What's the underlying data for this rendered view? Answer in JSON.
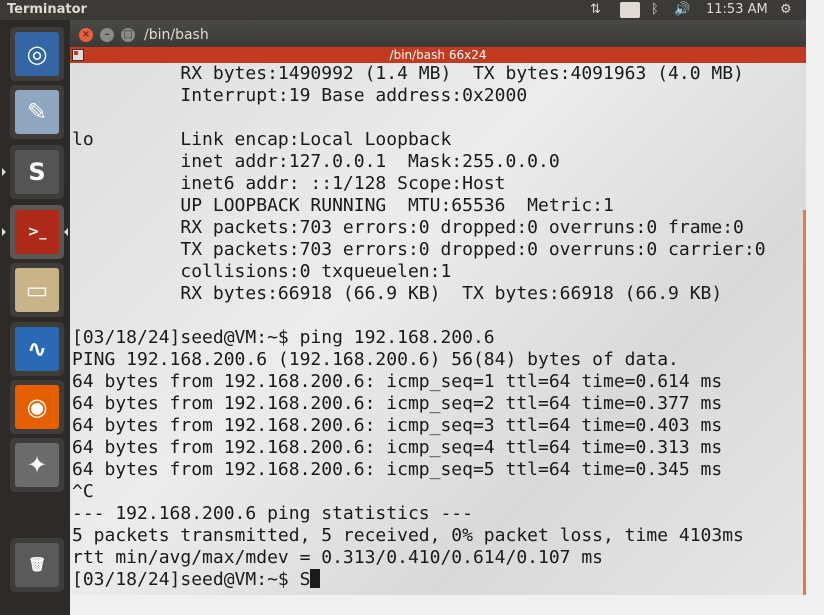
{
  "panel": {
    "app_title": "Terminator",
    "keyboard": "En",
    "clock": "11:53 AM",
    "network_glyph": "⇅",
    "bluetooth_glyph": "ᛒ",
    "volume_glyph": "🔊",
    "gear_glyph": "⚙"
  },
  "launcher": {
    "items": [
      {
        "name": "ubuntu-dash-icon",
        "glyph": "◎",
        "color": "#3465a4"
      },
      {
        "name": "text-editor-icon",
        "glyph": "✎",
        "color": "#8fa6bf"
      },
      {
        "name": "sublime-text-icon",
        "glyph": "S",
        "color": "#555555"
      },
      {
        "name": "terminator-icon",
        "glyph": ">_",
        "color": "#b02a1a"
      },
      {
        "name": "file-manager-icon",
        "glyph": "▭",
        "color": "#c9b48a"
      },
      {
        "name": "wireshark-icon",
        "glyph": "∿",
        "color": "#2a6ab4"
      },
      {
        "name": "firefox-icon",
        "glyph": "◉",
        "color": "#e66000"
      },
      {
        "name": "system-settings-icon",
        "glyph": "✦",
        "color": "#6b6b6b"
      },
      {
        "name": "trash-icon",
        "glyph": "🗑",
        "color": "#5a5a5a"
      }
    ]
  },
  "window": {
    "title": "/bin/bash",
    "close_glyph": "×",
    "min_glyph": "–",
    "max_glyph": "□"
  },
  "terminal": {
    "bar_title": "/bin/bash 66x24",
    "lines": [
      "          RX bytes:1490992 (1.4 MB)  TX bytes:4091963 (4.0 MB)",
      "          Interrupt:19 Base address:0x2000",
      "",
      "lo        Link encap:Local Loopback",
      "          inet addr:127.0.0.1  Mask:255.0.0.0",
      "          inet6 addr: ::1/128 Scope:Host",
      "          UP LOOPBACK RUNNING  MTU:65536  Metric:1",
      "          RX packets:703 errors:0 dropped:0 overruns:0 frame:0",
      "          TX packets:703 errors:0 dropped:0 overruns:0 carrier:0",
      "          collisions:0 txqueuelen:1",
      "          RX bytes:66918 (66.9 KB)  TX bytes:66918 (66.9 KB)",
      "",
      "[03/18/24]seed@VM:~$ ping 192.168.200.6",
      "PING 192.168.200.6 (192.168.200.6) 56(84) bytes of data.",
      "64 bytes from 192.168.200.6: icmp_seq=1 ttl=64 time=0.614 ms",
      "64 bytes from 192.168.200.6: icmp_seq=2 ttl=64 time=0.377 ms",
      "64 bytes from 192.168.200.6: icmp_seq=3 ttl=64 time=0.403 ms",
      "64 bytes from 192.168.200.6: icmp_seq=4 ttl=64 time=0.313 ms",
      "64 bytes from 192.168.200.6: icmp_seq=5 ttl=64 time=0.345 ms",
      "^C",
      "--- 192.168.200.6 ping statistics ---",
      "5 packets transmitted, 5 received, 0% packet loss, time 4103ms",
      "rtt min/avg/max/mdev = 0.313/0.410/0.614/0.107 ms"
    ],
    "prompt_line": "[03/18/24]seed@VM:~$ S"
  }
}
